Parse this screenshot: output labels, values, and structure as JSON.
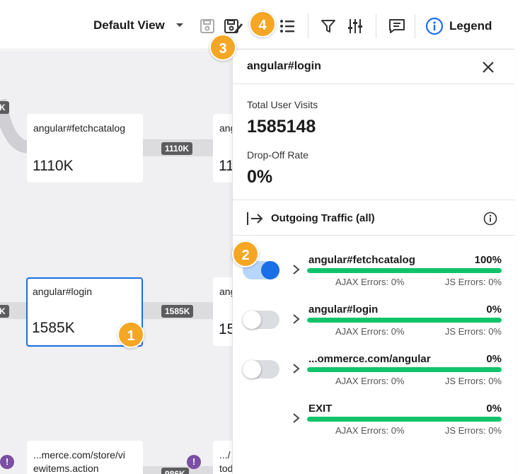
{
  "toolbar": {
    "view_label": "Default View",
    "legend_label": "Legend"
  },
  "canvas": {
    "nodes": [
      {
        "name": "angular#fetchcatalog",
        "count": "1110K"
      },
      {
        "name": "ang",
        "count": "11"
      },
      {
        "name": "angular#login",
        "count": "1585K"
      },
      {
        "name": "ang",
        "count": "15"
      },
      {
        "name": "...merce.com/store/vi ewitems.action",
        "count": ""
      },
      {
        "name": ".../ tod",
        "count": ""
      }
    ],
    "edge_labels": [
      "1110K",
      "1585K",
      "986K",
      "K",
      "K"
    ],
    "warn_symbol": "!"
  },
  "badges": [
    "1",
    "2",
    "3",
    "4"
  ],
  "panel": {
    "title": "angular#login",
    "total_visits_label": "Total User Visits",
    "total_visits_value": "1585148",
    "dropoff_label": "Drop-Off Rate",
    "dropoff_value": "0%",
    "traffic_title": "Outgoing Traffic (all)",
    "rows": [
      {
        "name": "angular#fetchcatalog",
        "pct": "100%",
        "fill": 1.0,
        "ajax": "AJAX Errors: 0%",
        "js": "JS Errors: 0%",
        "toggle": "on"
      },
      {
        "name": "angular#login",
        "pct": "0%",
        "fill": 1.0,
        "ajax": "AJAX Errors: 0%",
        "js": "JS Errors: 0%",
        "toggle": "off"
      },
      {
        "name": "...ommerce.com/angular",
        "pct": "0%",
        "fill": 1.0,
        "ajax": "AJAX Errors: 0%",
        "js": "JS Errors: 0%",
        "toggle": "off"
      },
      {
        "name": "EXIT",
        "pct": "0%",
        "fill": 1.0,
        "ajax": "AJAX Errors: 0%",
        "js": "JS Errors: 0%",
        "toggle": "none"
      }
    ]
  },
  "colors": {
    "accent": "#1a6fe8",
    "progress": "#11c46b",
    "badge": "#f5a623",
    "warning": "#7b4fa3"
  }
}
